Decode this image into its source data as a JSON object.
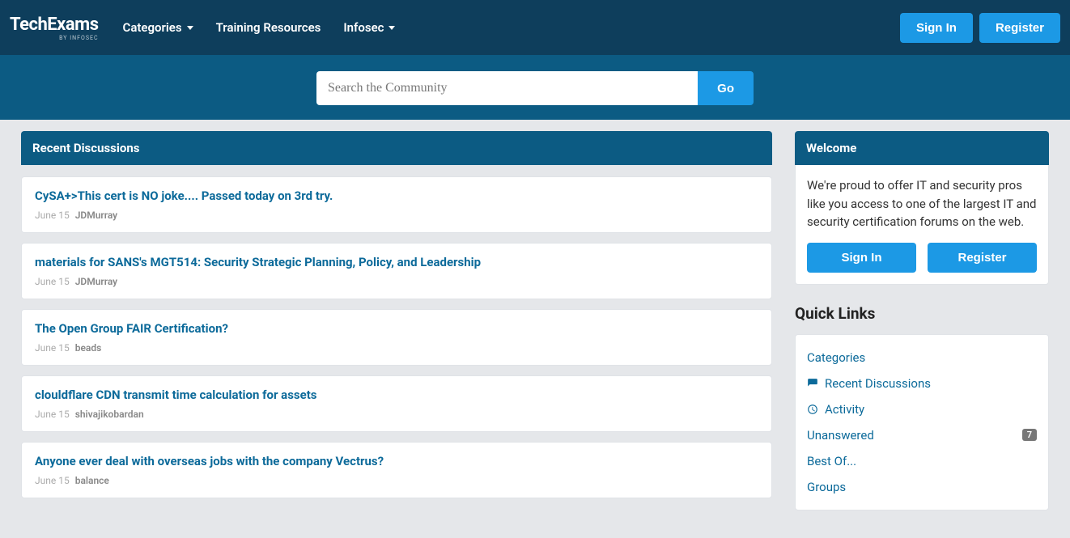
{
  "logo": {
    "main": "TechExams",
    "sub": "BY INFOSEC"
  },
  "nav": {
    "categories": "Categories",
    "training": "Training Resources",
    "infosec": "Infosec",
    "sign_in": "Sign In",
    "register": "Register"
  },
  "search": {
    "placeholder": "Search the Community",
    "button": "Go"
  },
  "main": {
    "panel_title": "Recent Discussions",
    "items": [
      {
        "title": "CySA+>This cert is NO joke.... Passed today on 3rd try.",
        "date": "June 15",
        "author": "JDMurray"
      },
      {
        "title": "materials for SANS's MGT514: Security Strategic Planning, Policy, and Leadership",
        "date": "June 15",
        "author": "JDMurray"
      },
      {
        "title": "The Open Group FAIR Certification?",
        "date": "June 15",
        "author": "beads"
      },
      {
        "title": "clouldflare CDN transmit time calculation for assets",
        "date": "June 15",
        "author": "shivajikobardan"
      },
      {
        "title": "Anyone ever deal with overseas jobs with the company Vectrus?",
        "date": "June 15",
        "author": "balance"
      }
    ]
  },
  "sidebar": {
    "welcome_title": "Welcome",
    "welcome_text": "We're proud to offer IT and security pros like you access to one of the largest IT and security certification forums on the web.",
    "sign_in": "Sign In",
    "register": "Register",
    "quick_links_title": "Quick Links",
    "links": {
      "categories": "Categories",
      "recent": "Recent Discussions",
      "activity": "Activity",
      "unanswered": "Unanswered",
      "unanswered_count": "7",
      "best_of": "Best Of...",
      "groups": "Groups"
    }
  }
}
